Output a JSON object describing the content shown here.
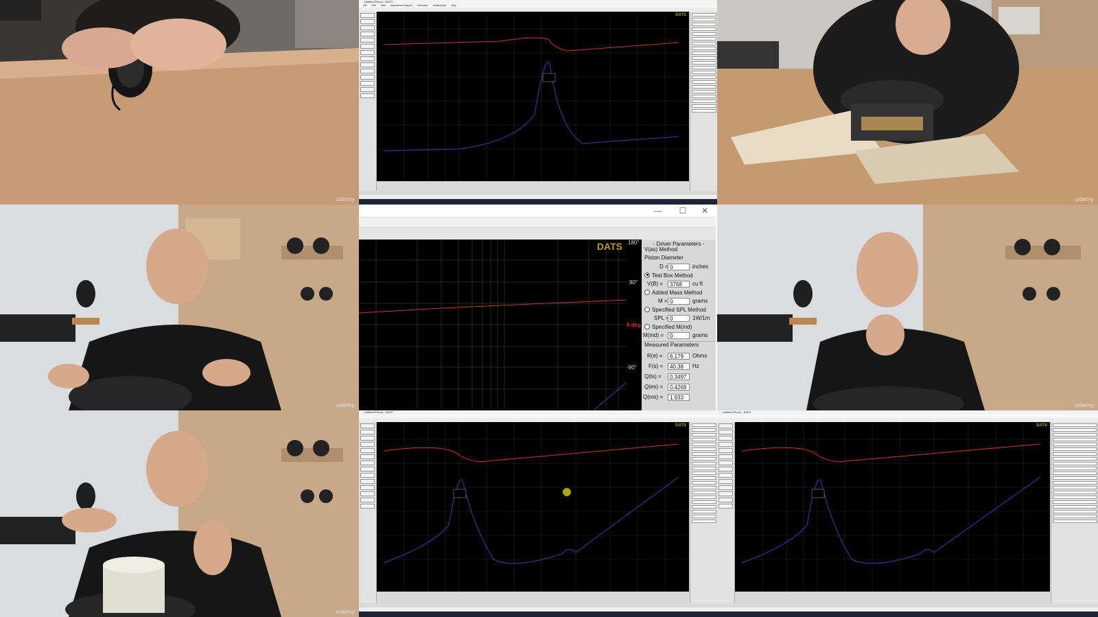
{
  "watermark": "udemy",
  "top_center": {
    "title": "Untitled-FR.pro - DATS",
    "menu": [
      "File",
      "Edit",
      "View",
      "Impedance Analyzer",
      "Generator",
      "Oscilloscope",
      "Help"
    ],
    "dats_label": "DATS"
  },
  "center": {
    "window_buttons": [
      "—",
      "☐",
      "✕"
    ],
    "dats_label": "DATS",
    "phase_ticks": [
      "180°",
      "90°",
      "0 deg",
      "-90°"
    ],
    "params": {
      "header": "- Driver Parameters -",
      "vas_method": "V(as) Method",
      "piston_diameter": "Piston Diameter",
      "d_label": "D =",
      "d_value": "0",
      "d_unit": "inches",
      "test_box_method": "Test Box Method",
      "vb_label": "V(B) =",
      "vb_value": "3768",
      "vb_unit": "cu ft",
      "added_mass_method": "Added Mass Method",
      "m_label": "M =",
      "m_value": "0",
      "m_unit": "grams",
      "specified_spl_method": "Specified SPL Method",
      "spl_label": "SPL =",
      "spl_value": "0",
      "spl_unit": "1W/1m",
      "specified_mmd": "Specified M(md)",
      "mmd_label": "M(md) =",
      "mmd_value": "0",
      "mmd_unit": "grams",
      "measured_header": "Measured Parameters",
      "re_label": "R(e) =",
      "re_value": "6.179",
      "re_unit": "Ohms",
      "fs_label": "F(s) =",
      "fs_value": "40.38",
      "fs_unit": "Hz",
      "qts_label": "Q(ts) =",
      "qts_value": "0.3497",
      "qes_label": "Q(es) =",
      "qes_value": "0.4269",
      "qms_label": "Q(ms) =",
      "qms_value": "1.933"
    }
  },
  "bottom_center": {
    "title": "Untitled-FR.pro - DATS",
    "dats_label": "DATS"
  },
  "bottom_right": {
    "title": "Untitled-FR.pro - DATS",
    "dats_label": "DATS"
  },
  "colors": {
    "impedance_curve": "#3b3f9a",
    "phase_curve": "#c8382e",
    "dats_gold": "#b89a30",
    "highlight": "#d8d020"
  }
}
